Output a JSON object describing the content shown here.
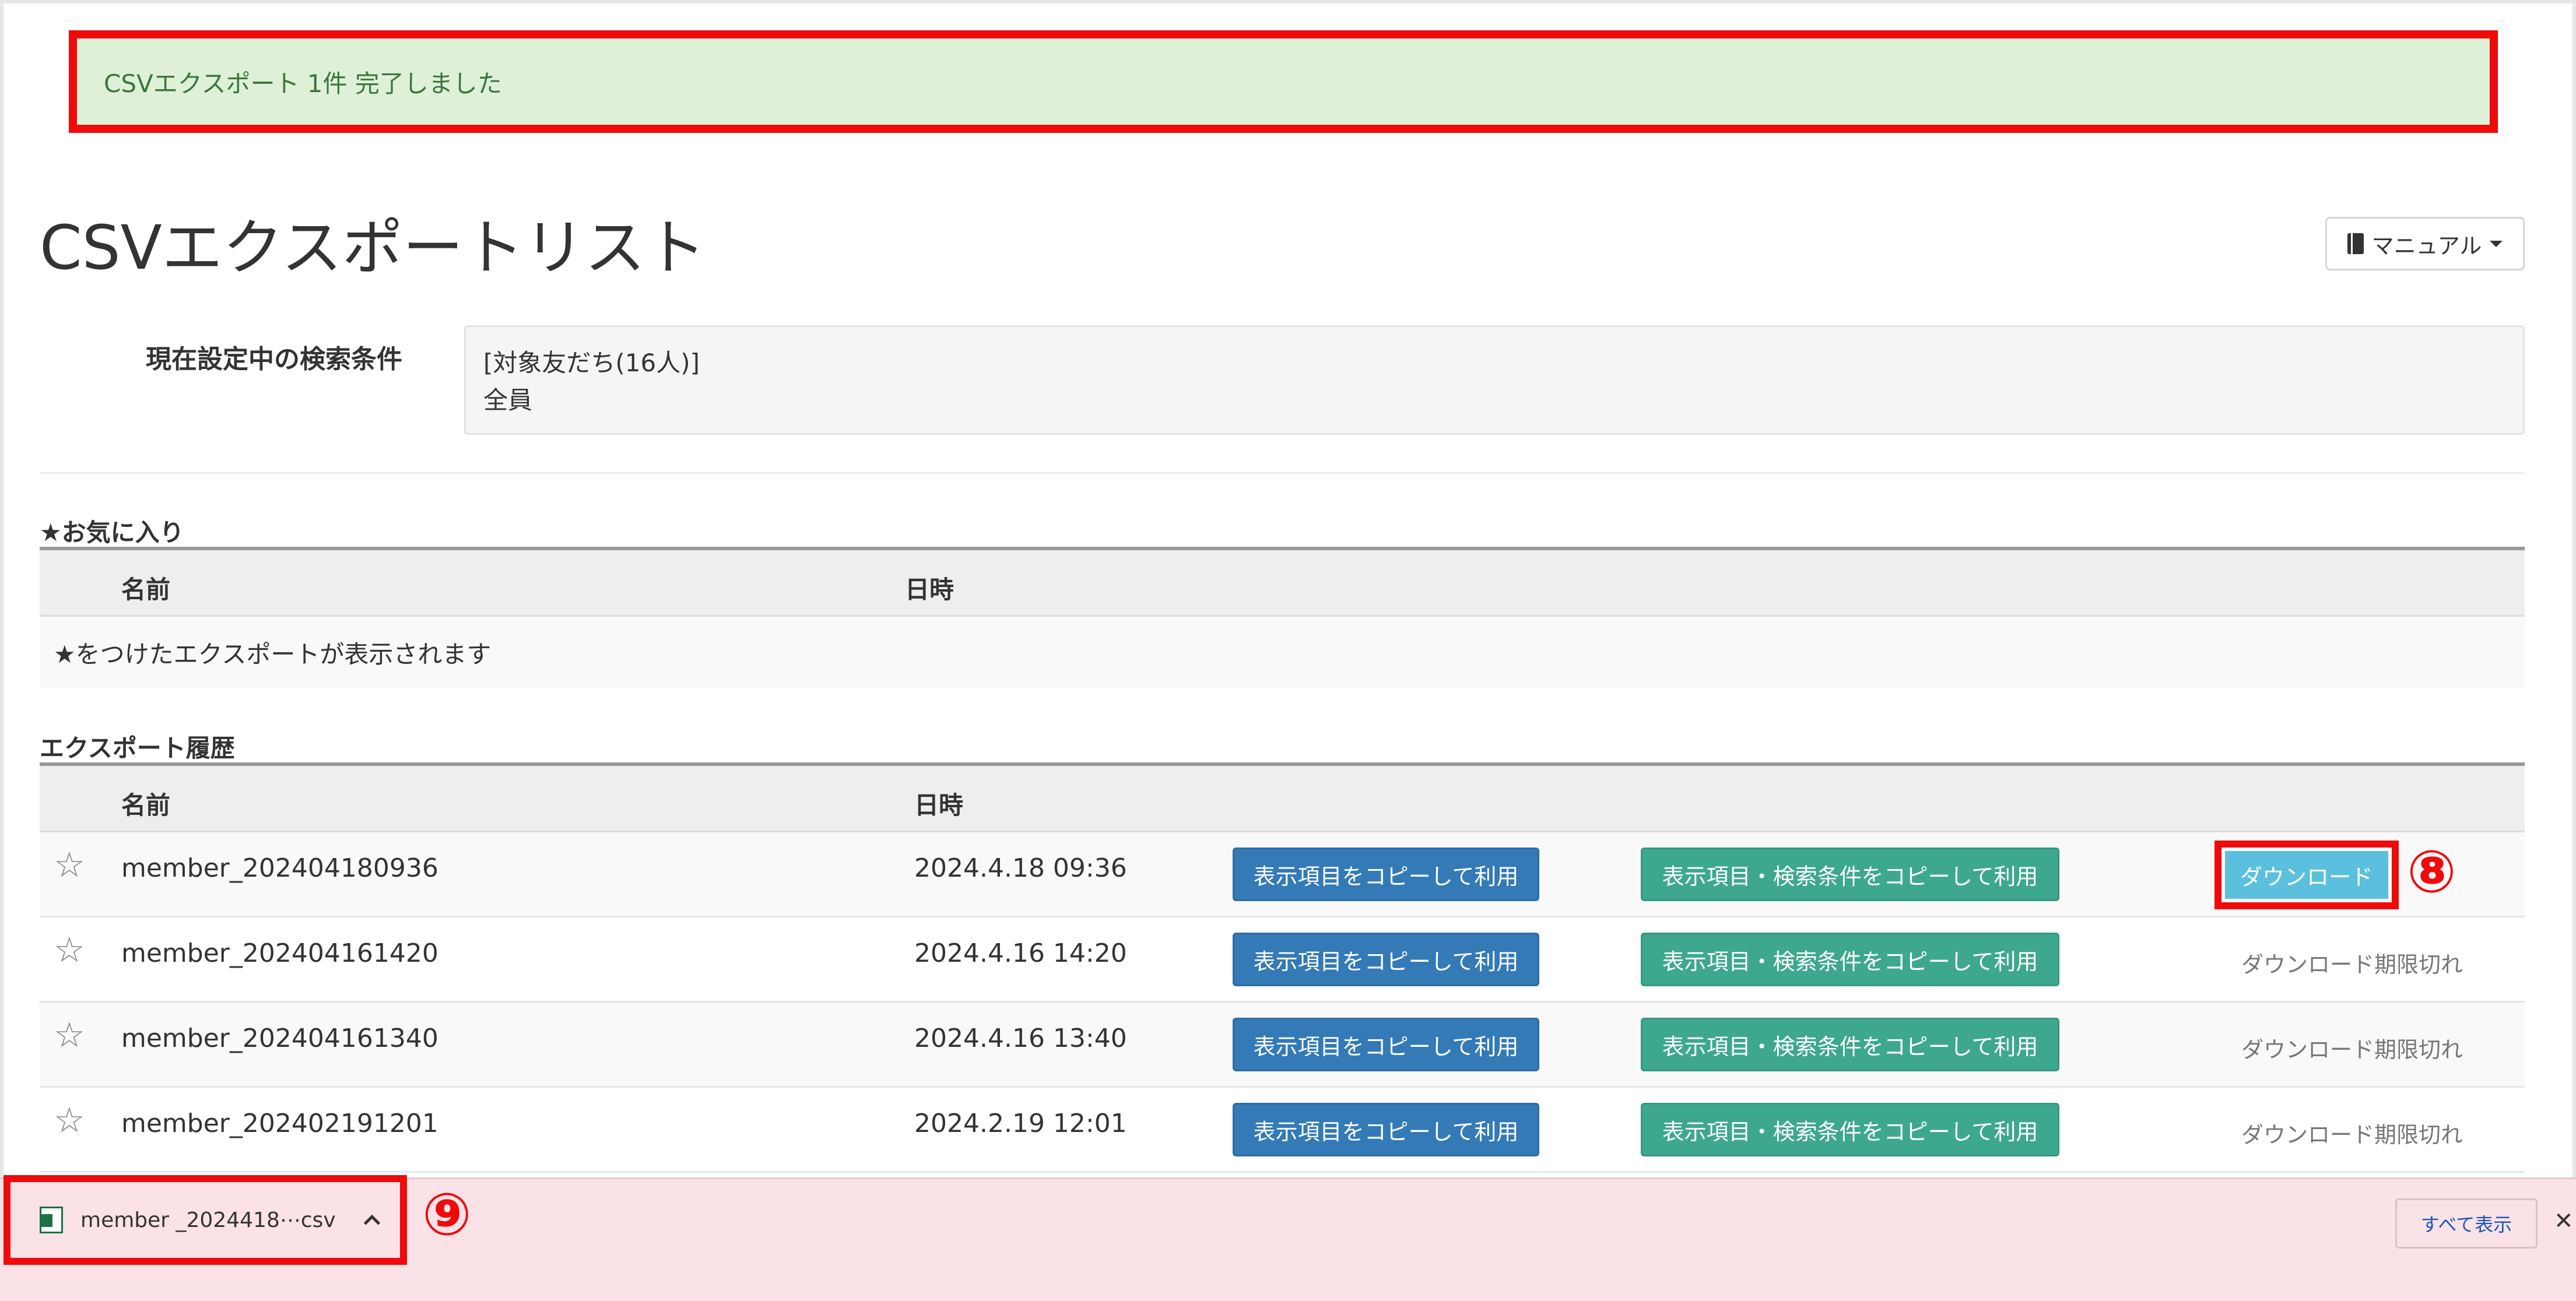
{
  "alert": {
    "message": "CSVエクスポート 1件 完了しました"
  },
  "header": {
    "title": "CSVエクスポートリスト",
    "manual_label": "マニュアル"
  },
  "condition": {
    "label": "現在設定中の検索条件",
    "line1": "[対象友だち(16人)]",
    "line2": "全員"
  },
  "favorites": {
    "title": "★お気に入り",
    "col_name": "名前",
    "col_date": "日時",
    "empty_text": "★をつけたエクスポートが表示されます"
  },
  "history": {
    "title": "エクスポート履歴",
    "col_name": "名前",
    "col_date": "日時",
    "copy_columns_label": "表示項目をコピーして利用",
    "copy_columns_conditions_label": "表示項目・検索条件をコピーして利用",
    "download_label": "ダウンロード",
    "expired_label": "ダウンロード期限切れ",
    "rows": [
      {
        "name": "member_202404180936",
        "date": "2024.4.18 09:36"
      },
      {
        "name": "member_202404161420",
        "date": "2024.4.16 14:20"
      },
      {
        "name": "member_202404161340",
        "date": "2024.4.16 13:40"
      },
      {
        "name": "member_202402191201",
        "date": "2024.2.19 12:01"
      }
    ]
  },
  "markers": {
    "m8": "⑧",
    "m9": "⑨"
  },
  "download_bar": {
    "file_name": "member _2024418⋯csv",
    "show_all_label": "すべて表示"
  },
  "colors": {
    "annotation_red": "#ee0b0b",
    "alert_bg": "#dff0d8",
    "primary_blue": "#337ab7",
    "green": "#3ea88e",
    "info_blue": "#5bc0de",
    "download_bar_bg": "#fbe2e6"
  },
  "icons": [
    "book-icon",
    "caret-down-icon",
    "star-icon",
    "excel-file-icon",
    "chevron-up-icon",
    "close-icon"
  ]
}
